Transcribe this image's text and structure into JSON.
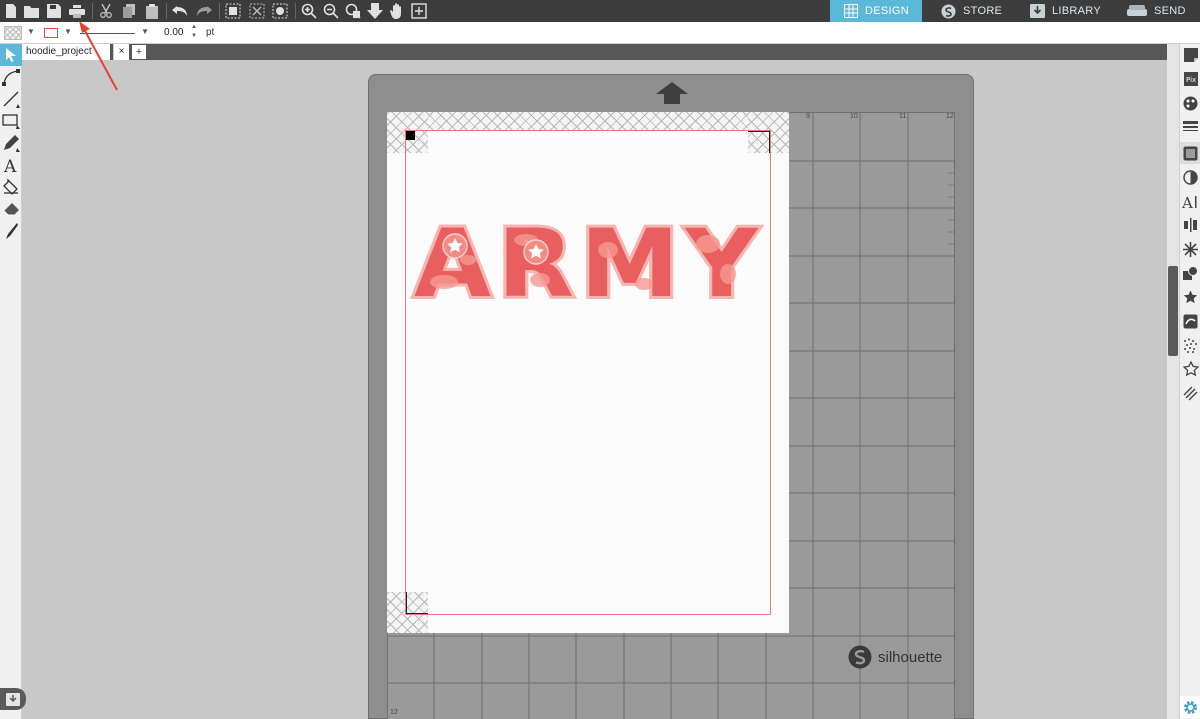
{
  "nav": {
    "design": "DESIGN",
    "store": "STORE",
    "library": "LIBRARY",
    "send": "SEND"
  },
  "colors": {
    "accent": "#5bb8d9",
    "toolbar": "#3c3c3c",
    "cut_line": "#e47b7b",
    "letter_fill": "#e95e5e",
    "letter_outline": "#f5b5b0",
    "arrow": "#e2452f"
  },
  "line_width": {
    "value": "0.00",
    "unit": "pt"
  },
  "document_tab": {
    "name": "hoodie_project",
    "close": "×",
    "add": "+"
  },
  "design_text": "ARMY",
  "ruler": {
    "top": [
      "9",
      "10",
      "11",
      "12"
    ],
    "corner": "12"
  },
  "brand": "silhouette",
  "icons": {
    "toolbar": [
      "new-document-icon",
      "open-folder-icon",
      "save-icon",
      "print-icon",
      "cut-icon",
      "copy-icon",
      "paste-icon",
      "undo-icon",
      "redo-icon",
      "group-icon",
      "ungroup-icon",
      "compound-icon",
      "zoom-in-icon",
      "zoom-out-icon",
      "zoom-selection-icon",
      "move-down-icon",
      "pan-hand-icon",
      "fit-page-icon"
    ],
    "left_tools": [
      "pointer-icon",
      "edit-points-icon",
      "line-icon",
      "rectangle-icon",
      "pencil-icon",
      "text-icon",
      "fill-bucket-icon",
      "eraser-icon",
      "knife-icon"
    ],
    "right_panel": [
      "page-setup-icon",
      "pixscan-icon",
      "fill-color-icon",
      "line-style-icon",
      "pattern-icon",
      "gradient-icon",
      "text-style-icon",
      "align-icon",
      "replicate-icon",
      "modify-icon",
      "offset-icon",
      "trace-icon",
      "sketch-icon",
      "favorites-icon",
      "rhinestone-icon",
      "settings-icon"
    ]
  }
}
